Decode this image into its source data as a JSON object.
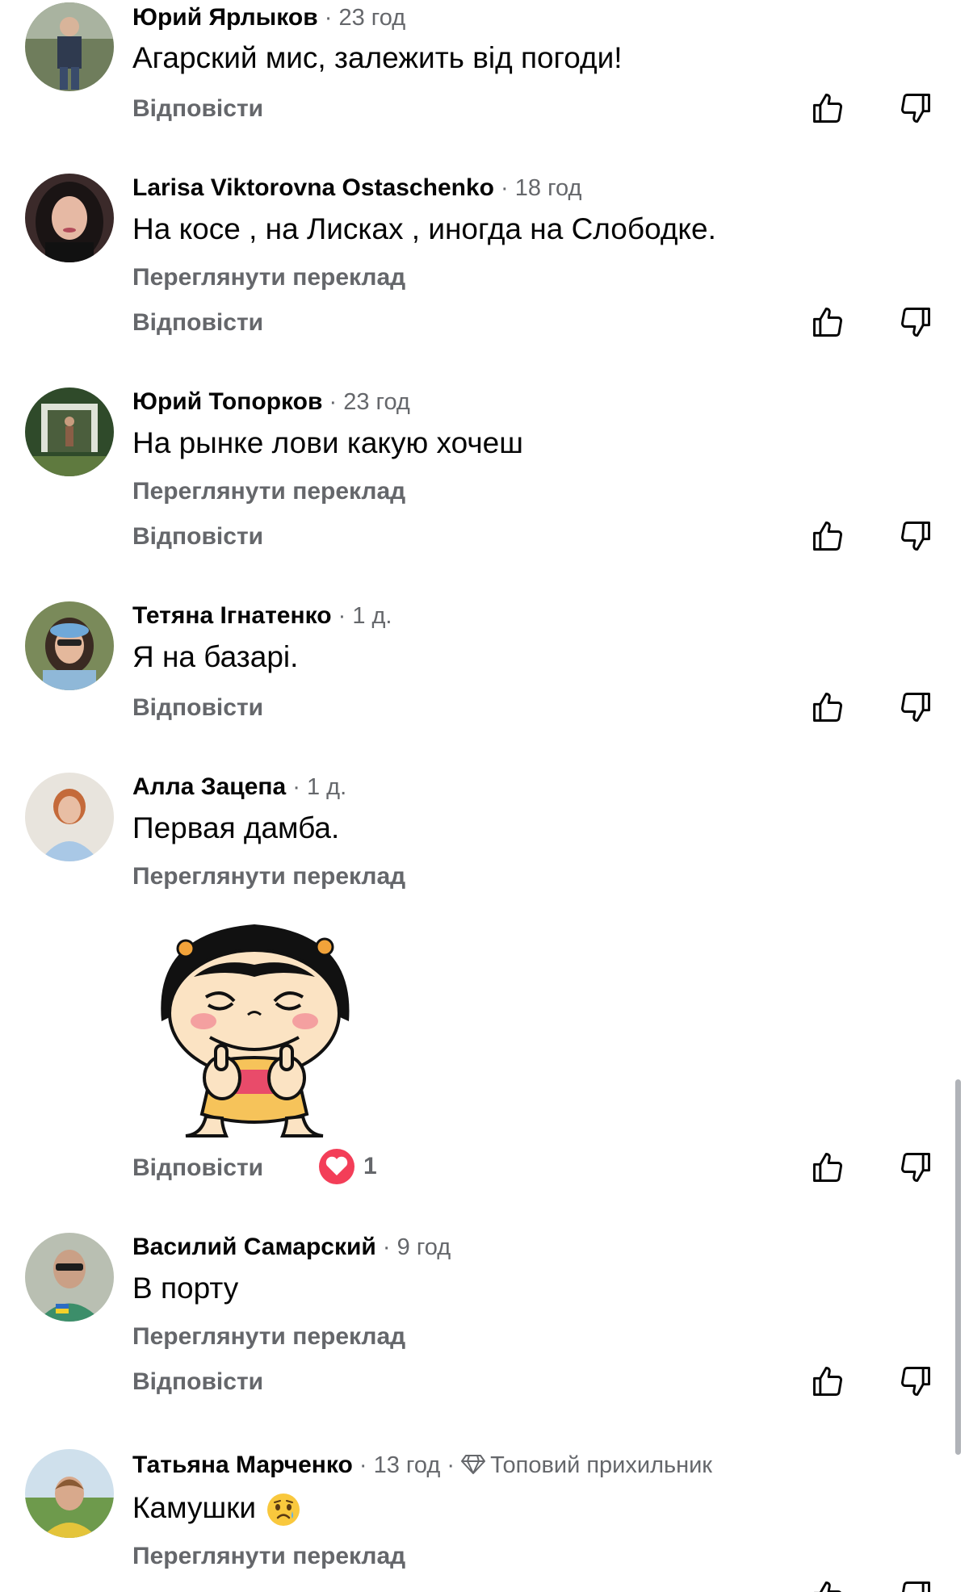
{
  "comments": [
    {
      "author": "Юрий Ярлыков",
      "time": "23 год",
      "text": "Агарский мис, залежить від погоди!",
      "reply_label": "Відповісти"
    },
    {
      "author": "Larisa Viktorovna Ostaschenko",
      "time": "18 год",
      "text": "На косе , на Лисках , иногда на Слободке.",
      "translate_label": "Переглянути переклад",
      "reply_label": "Відповісти"
    },
    {
      "author": "Юрий Топорков",
      "time": "23 год",
      "text": "На рынке лови какую хочеш",
      "translate_label": "Переглянути переклад",
      "reply_label": "Відповісти"
    },
    {
      "author": "Тетяна Ігнатенко",
      "time": "1 д.",
      "text": "Я на базарі.",
      "reply_label": "Відповісти"
    },
    {
      "author": "Алла Зацепа",
      "time": "1 д.",
      "text": "Первая дамба.",
      "translate_label": "Переглянути переклад",
      "reply_label": "Відповісти",
      "reaction_count": "1"
    },
    {
      "author": "Василий Самарский",
      "time": "9 год",
      "text": "В порту",
      "translate_label": "Переглянути переклад",
      "reply_label": "Відповісти"
    },
    {
      "author": "Татьяна Марченко",
      "time": "13 год",
      "badge": "Топовий прихильник",
      "text": "Камушки",
      "translate_label": "Переглянути переклад"
    }
  ],
  "separator": " · ",
  "icons": {
    "like": "thumbs-up-icon",
    "dislike": "thumbs-down-icon",
    "reaction": "heart-icon",
    "badge": "diamond-icon",
    "emoji": "sad-face-emoji",
    "sticker": "cartoon-girl-thumbs-up-sticker"
  },
  "colors": {
    "text": "#050505",
    "secondary": "#65676b",
    "heart": "#f33e58",
    "scrollbar": "#b0b3b8"
  }
}
